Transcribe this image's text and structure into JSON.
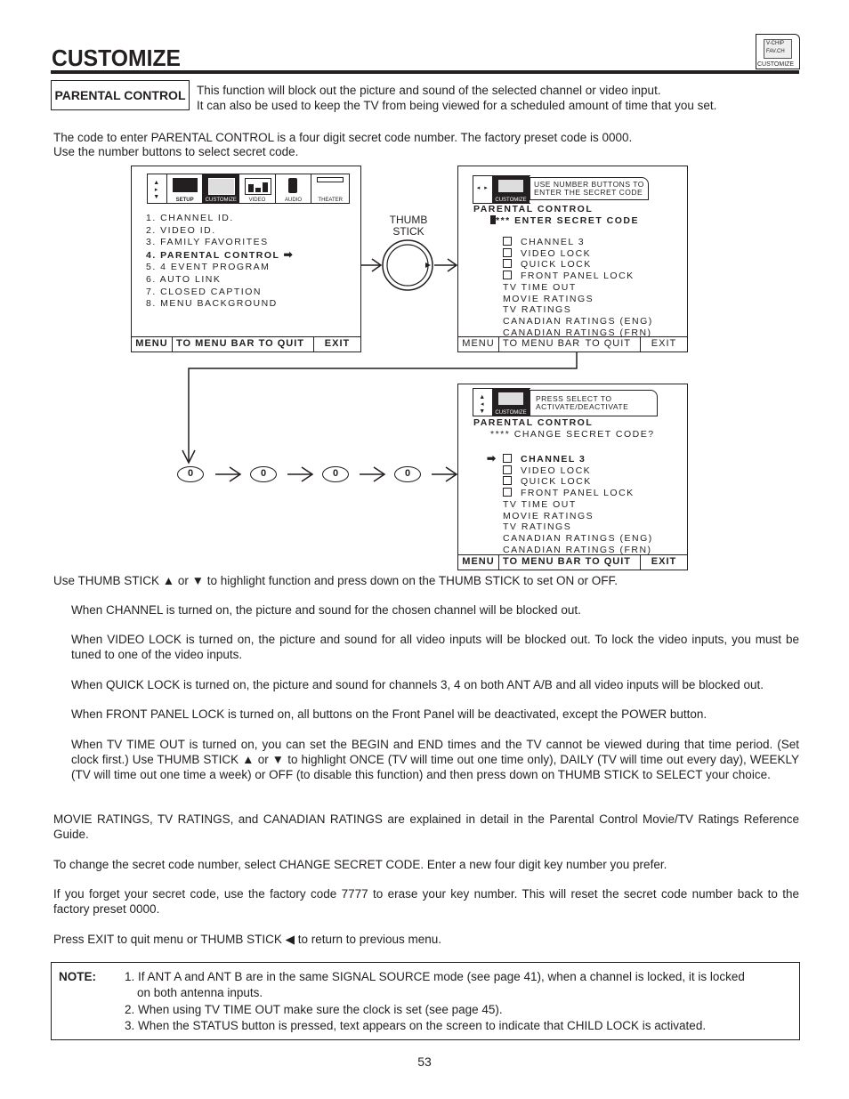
{
  "header": {
    "title": "CUSTOMIZE",
    "badge": {
      "icon": "customize-icon",
      "line1": "V-CHIP",
      "line2": "FAV.CH",
      "label": "CUSTOMIZE"
    }
  },
  "intro": {
    "section_label": "PARENTAL CONTROL",
    "line1": "This function will block out the picture and sound of the selected channel or video input.",
    "line2": "It can also be used to keep the TV from being viewed for a scheduled amount of time that you set.",
    "code_line1": "The code to enter PARENTAL CONTROL is a four digit secret code number.  The factory preset code is 0000.",
    "code_line2": "Use the number buttons to select secret code."
  },
  "screen1": {
    "tabs": [
      "SETUP",
      "CUSTOMIZE",
      "VIDEO",
      "AUDIO",
      "THEATER"
    ],
    "active_tab": "CUSTOMIZE",
    "items": [
      "1. CHANNEL ID.",
      "2. VIDEO ID.",
      "3. FAMILY FAVORITES",
      "4. PARENTAL CONTROL",
      "5. 4 EVENT PROGRAM",
      "6. AUTO LINK",
      "7. CLOSED CAPTION",
      "8. MENU BACKGROUND"
    ],
    "selected_index": 3,
    "menubar": {
      "menu": "MENU",
      "to_menu_bar": "TO MENU BAR",
      "to_quit": "TO QUIT",
      "exit": "EXIT"
    }
  },
  "thumbstick": {
    "label_line1": "THUMB",
    "label_line2": "STICK"
  },
  "screen2": {
    "tab_label": "CUSTOMIZE",
    "hint_line1": "USE NUMBER BUTTONS TO",
    "hint_line2": "ENTER THE SECRET CODE",
    "heading": "PARENTAL CONTROL",
    "code_prompt": "*** ENTER SECRET CODE",
    "checkbox_items": [
      "CHANNEL 3",
      "VIDEO LOCK",
      "QUICK LOCK",
      "FRONT PANEL LOCK"
    ],
    "other_items": [
      "TV TIME OUT",
      "MOVIE RATINGS",
      "TV RATINGS",
      "CANADIAN RATINGS (ENG)",
      "CANADIAN RATINGS (FRN)"
    ],
    "menubar": {
      "menu": "MENU",
      "to_menu_bar": "TO MENU BAR",
      "to_quit": "TO QUIT",
      "exit": "EXIT"
    }
  },
  "code_entry": {
    "digits": [
      "0",
      "0",
      "0",
      "0"
    ]
  },
  "screen3": {
    "tab_label": "CUSTOMIZE",
    "hint_line1": "PRESS SELECT TO",
    "hint_line2": "ACTIVATE/DEACTIVATE",
    "heading": "PARENTAL CONTROL",
    "code_prompt": "**** CHANGE SECRET CODE?",
    "checkbox_items": [
      "CHANNEL 3",
      "VIDEO LOCK",
      "QUICK LOCK",
      "FRONT PANEL LOCK"
    ],
    "selected_index": 0,
    "other_items": [
      "TV TIME OUT",
      "MOVIE RATINGS",
      "TV RATINGS",
      "CANADIAN RATINGS (ENG)",
      "CANADIAN RATINGS (FRN)"
    ],
    "menubar": {
      "menu": "MENU",
      "to_menu_bar": "TO MENU BAR",
      "to_quit": "TO QUIT",
      "exit": "EXIT"
    }
  },
  "body": {
    "p_thumb": "Use THUMB STICK ▲ or ▼ to highlight function and press down on the THUMB STICK to set ON or OFF.",
    "p_channel": "When CHANNEL is turned on, the picture and sound for the chosen channel will be blocked out.",
    "p_video": "When VIDEO LOCK is turned on, the picture and sound for all video inputs will be blocked out. To lock the video inputs, you must be tuned to one of the video inputs.",
    "p_quick": "When QUICK LOCK is turned on, the picture and sound for channels 3, 4 on both ANT A/B and all video inputs will be blocked out.",
    "p_front": "When FRONT PANEL LOCK is turned on, all buttons on the Front Panel will be deactivated, except the POWER button.",
    "p_timeout": "When TV TIME OUT is turned on, you can set the BEGIN and END times and the TV cannot be viewed during that time period. (Set clock first.) Use THUMB STICK ▲ or ▼ to highlight ONCE (TV will time out one time only), DAILY (TV will time out every day), WEEKLY (TV will time out one time a week) or OFF (to disable this function) and then press down on THUMB STICK to SELECT your choice.",
    "p_ratings": "MOVIE RATINGS, TV RATINGS, and CANADIAN RATINGS are explained in detail in the Parental Control Movie/TV Ratings Reference Guide.",
    "p_change": "To change the secret code number, select CHANGE SECRET CODE.  Enter a new four digit key number you prefer.",
    "p_forget": "If you forget your secret code, use the factory code 7777 to erase your key number. This will reset the secret code number back to the factory preset 0000.",
    "p_exit": "Press EXIT to quit menu or THUMB STICK ◀ to return to previous menu."
  },
  "note": {
    "label": "NOTE:",
    "items": [
      "1. If ANT A and ANT B are in the same SIGNAL SOURCE mode (see page 41), when a channel is locked, it is locked",
      "on both antenna inputs.",
      "2. When using TV TIME OUT make sure the clock is set (see page 45).",
      "3. When the STATUS button is pressed, text appears on the screen to indicate that CHILD LOCK is activated."
    ]
  },
  "page_number": "53"
}
